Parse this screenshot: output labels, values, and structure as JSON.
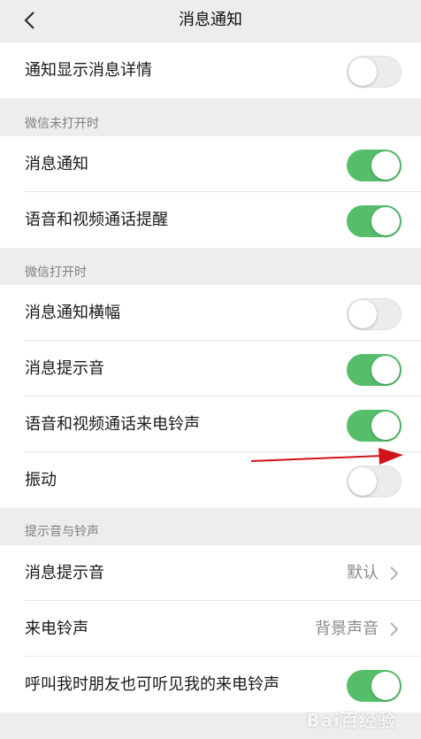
{
  "header": {
    "title": "消息通知"
  },
  "top": {
    "detail_label": "通知显示消息详情",
    "detail_on": false
  },
  "section_closed": {
    "header": "微信未打开时",
    "items": [
      {
        "label": "消息通知",
        "on": true
      },
      {
        "label": "语音和视频通话提醒",
        "on": true
      }
    ]
  },
  "section_open": {
    "header": "微信打开时",
    "items": [
      {
        "label": "消息通知横幅",
        "on": false
      },
      {
        "label": "消息提示音",
        "on": true
      },
      {
        "label": "语音和视频通话来电铃声",
        "on": true
      },
      {
        "label": "振动",
        "on": false
      }
    ]
  },
  "section_sound": {
    "header": "提示音与铃声",
    "items": [
      {
        "label": "消息提示音",
        "value": "默认"
      },
      {
        "label": "来电铃声",
        "value": "背景声音"
      }
    ],
    "friends_ring_label": "呼叫我时朋友也可听见我的来电铃声",
    "friends_ring_on": true
  },
  "watermark": "Bai百经验",
  "colors": {
    "toggle_on": "#56be6a",
    "annotation_arrow": "#d0131a"
  }
}
